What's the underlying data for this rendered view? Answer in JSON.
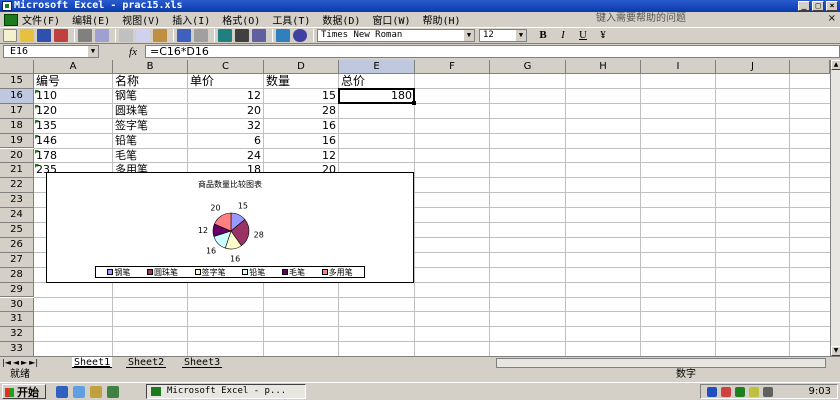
{
  "window": {
    "title": "Microsoft Excel - prac15.xls",
    "min": "_",
    "max": "□",
    "close": "×"
  },
  "menubar": {
    "items": [
      "文件(F)",
      "编辑(E)",
      "视图(V)",
      "插入(I)",
      "格式(O)",
      "工具(T)",
      "数据(D)",
      "窗口(W)",
      "帮助(H)"
    ],
    "help_placeholder": "键入需要帮助的问题",
    "close": "×"
  },
  "toolbar": {
    "font_name": "Times New Roman",
    "font_size": "12",
    "bold": "B",
    "italic": "I",
    "underline": "U",
    "currency": "¥"
  },
  "formula_bar": {
    "name_box": "E16",
    "fx": "fx",
    "formula": "=C16*D16"
  },
  "grid": {
    "columns": [
      "A",
      "B",
      "C",
      "D",
      "E",
      "F",
      "G",
      "H",
      "I",
      "J"
    ],
    "rows": [
      "15",
      "16",
      "17",
      "18",
      "19",
      "20",
      "21",
      "22",
      "23",
      "24",
      "25",
      "26",
      "27",
      "28",
      "29",
      "30",
      "31",
      "32",
      "33",
      "34",
      "35"
    ],
    "header": [
      "编号",
      "名称",
      "单价",
      "数量",
      "总价"
    ],
    "data": [
      [
        "110",
        "钢笔",
        "12",
        "15",
        "180"
      ],
      [
        "120",
        "圆珠笔",
        "20",
        "28",
        ""
      ],
      [
        "135",
        "签字笔",
        "32",
        "16",
        ""
      ],
      [
        "146",
        "铅笔",
        "6",
        "16",
        ""
      ],
      [
        "178",
        "毛笔",
        "24",
        "12",
        ""
      ],
      [
        "235",
        "多用笔",
        "18",
        "20",
        ""
      ]
    ],
    "selected_cell": "E16"
  },
  "chart_data": {
    "type": "pie",
    "title": "商品数量比较图表",
    "categories": [
      "钢笔",
      "圆珠笔",
      "签字笔",
      "铅笔",
      "毛笔",
      "多用笔"
    ],
    "values": [
      15,
      28,
      16,
      16,
      12,
      20
    ],
    "colors": [
      "#9999ff",
      "#993366",
      "#ffffcc",
      "#ccffff",
      "#660066",
      "#ff8080"
    ],
    "data_labels": [
      "15",
      "28",
      "16",
      "16",
      "12",
      "20"
    ],
    "legend_position": "bottom"
  },
  "sheets": {
    "tabs": [
      "Sheet1",
      "Sheet2",
      "Sheet3"
    ],
    "active": "Sheet1"
  },
  "status": {
    "left": "就绪",
    "mode": "数字"
  },
  "taskbar": {
    "start": "开始",
    "task": "Microsoft Excel - p...",
    "clock": "9:03"
  }
}
